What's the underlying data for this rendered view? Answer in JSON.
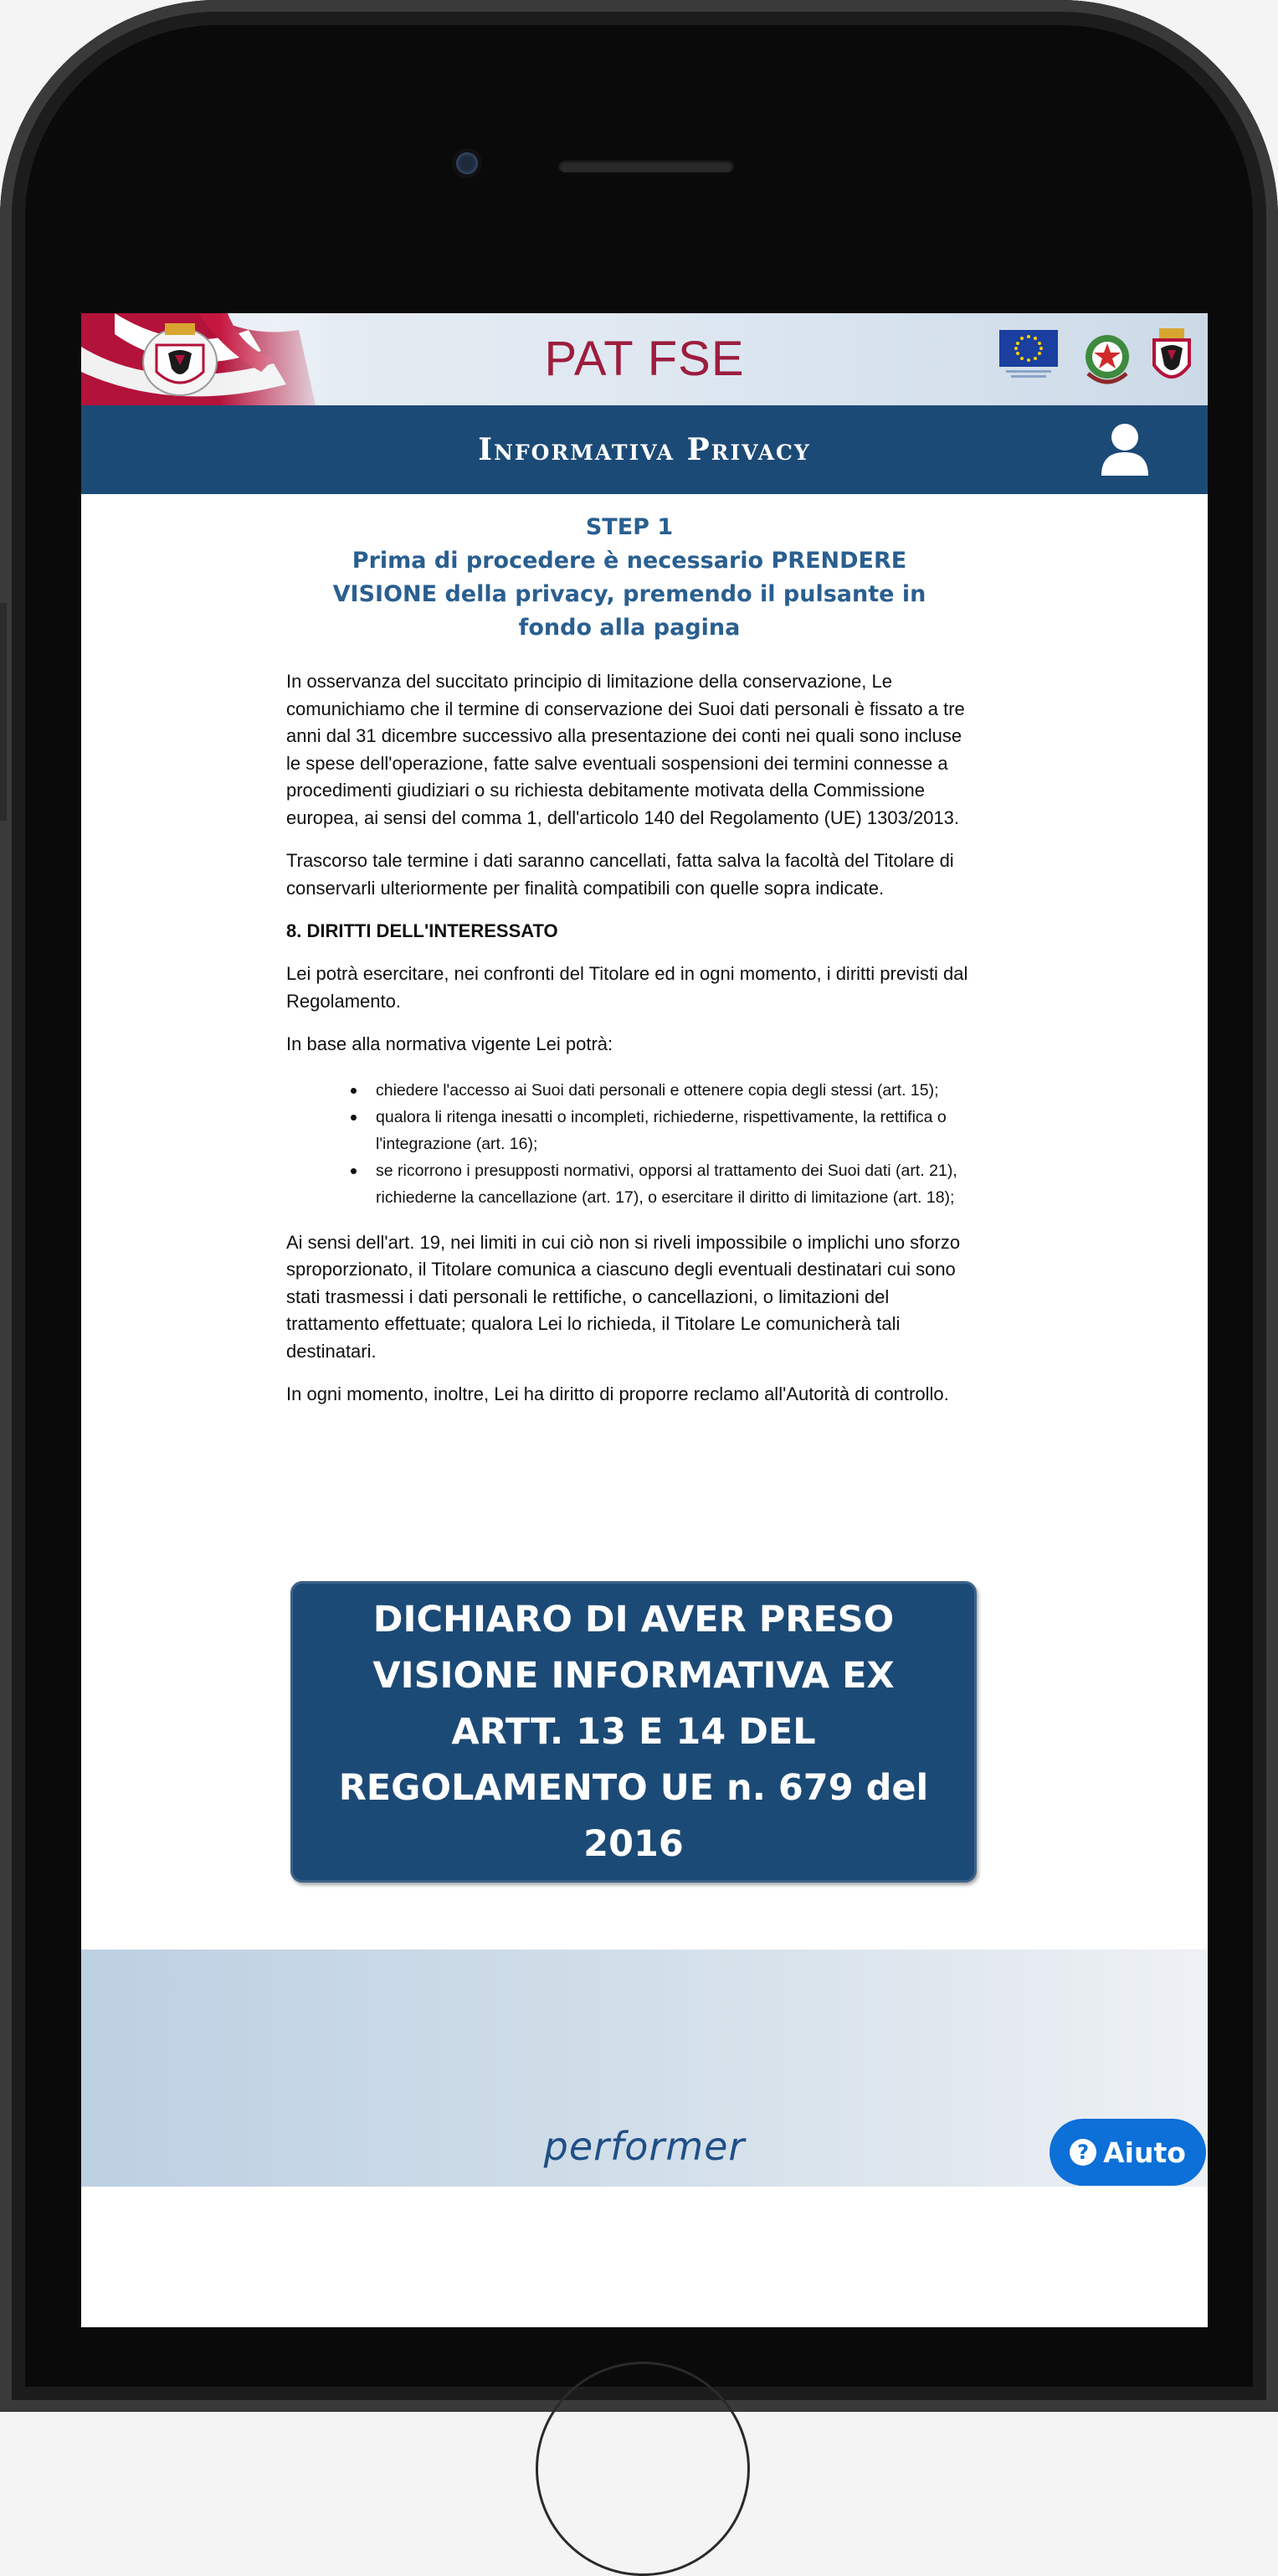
{
  "topbar": {
    "app_title": "PAT FSE"
  },
  "header": {
    "title": "Informativa Privacy"
  },
  "step": {
    "label": "STEP 1",
    "instruction": "Prima di procedere è necessario PRENDERE VISIONE della privacy, premendo il pulsante in fondo alla pagina"
  },
  "content": {
    "paragraph_1": "In osservanza del succitato principio di limitazione della conservazione, Le comunichiamo che il termine di conservazione dei Suoi dati personali è fissato a tre anni dal 31 dicembre successivo alla presentazione dei conti nei quali sono incluse le spese dell'operazione, fatte salve eventuali sospensioni dei termini connesse a procedimenti giudiziari o su richiesta debitamente motivata della Commissione europea, ai sensi del comma 1, dell'articolo 140 del Regolamento (UE) 1303/2013.",
    "paragraph_2": "Trascorso tale termine i dati saranno cancellati, fatta salva la facoltà del Titolare di conservarli ulteriormente per finalità compatibili con quelle sopra indicate.",
    "section_heading": "8. DIRITTI DELL'INTERESSATO",
    "paragraph_3": "Lei potrà esercitare, nei confronti del Titolare ed in ogni momento, i diritti previsti dal Regolamento.",
    "paragraph_4": "In base alla normativa vigente Lei potrà:",
    "rights": [
      "chiedere l'accesso ai Suoi dati personali e ottenere copia degli stessi (art. 15);",
      "qualora li ritenga inesatti o incompleti, richiederne, rispettivamente, la rettifica o l'integrazione (art. 16);",
      "se ricorrono i presupposti normativi, opporsi al trattamento dei Suoi dati (art. 21), richiederne la cancellazione (art. 17), o esercitare il diritto di limitazione (art. 18);"
    ],
    "paragraph_5": "Ai sensi dell'art. 19, nei limiti in cui ciò non si riveli impossibile o implichi uno sforzo sproporzionato, il Titolare comunica a ciascuno degli eventuali destinatari cui sono stati trasmessi i dati personali le rettifiche, o cancellazioni, o limitazioni del trattamento effettuate; qualora Lei lo richieda, il Titolare Le comunicherà tali destinatari.",
    "paragraph_6": "In ogni momento, inoltre, Lei ha diritto di proporre reclamo all'Autorità di controllo."
  },
  "confirm_button": {
    "label": "DICHIARO DI AVER PRESO VISIONE INFORMATIVA EX ARTT. 13 E 14 DEL REGOLAMENTO UE n. 679 del 2016"
  },
  "footer": {
    "brand": "performer"
  },
  "help_button": {
    "icon": "?",
    "label": "Aiuto"
  },
  "icons": {
    "user": "user-icon",
    "help": "question-circle-icon"
  },
  "colors": {
    "header_bg": "#1c4a76",
    "title_accent": "#9c1d3e",
    "step_text": "#2a5f8f",
    "help_button": "#0d6fd8"
  }
}
